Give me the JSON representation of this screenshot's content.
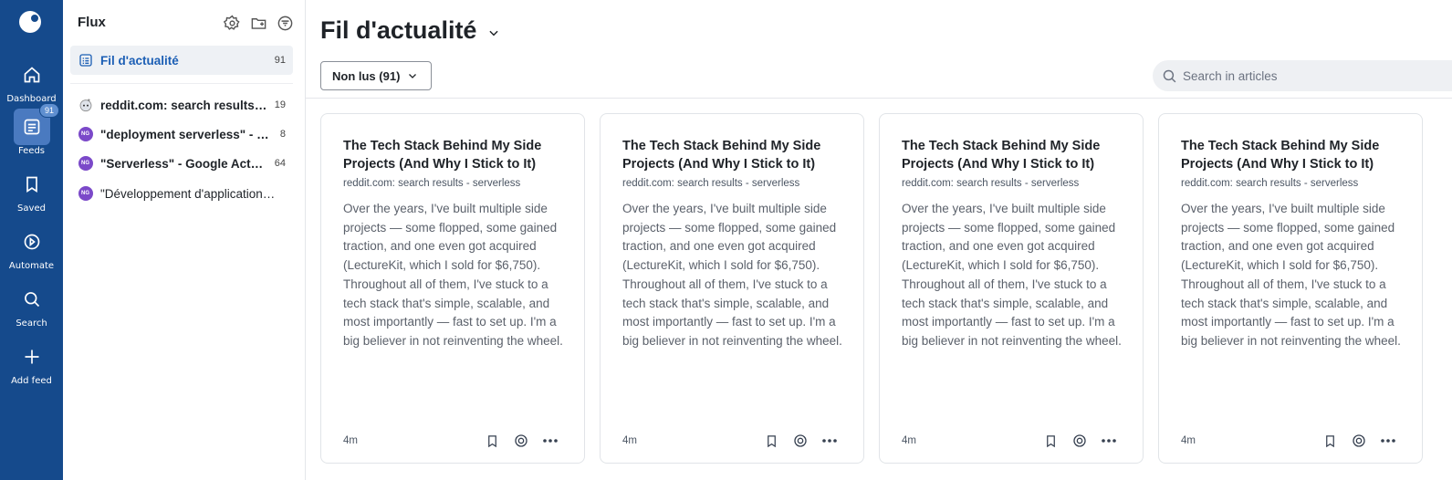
{
  "rail": {
    "items": [
      {
        "label": "Dashboard",
        "icon": "home-icon"
      },
      {
        "label": "Feeds",
        "icon": "feeds-icon",
        "badge": "91"
      },
      {
        "label": "Saved",
        "icon": "bookmark-icon"
      },
      {
        "label": "Automate",
        "icon": "automate-icon"
      },
      {
        "label": "Search",
        "icon": "search-icon"
      },
      {
        "label": "Add feed",
        "icon": "plus-icon"
      }
    ]
  },
  "panel": {
    "title": "Flux",
    "rows": [
      {
        "label": "Fil d'actualité",
        "count": "91",
        "icon": "feed-list-icon"
      },
      {
        "label": "reddit.com: search results - serverless",
        "count": "19",
        "icon": "reddit-icon"
      },
      {
        "label": "\"deployment serverless\" - Google Alerts",
        "count": "8",
        "icon": "ng-avatar",
        "avatar": "NG"
      },
      {
        "label": "\"Serverless\" - Google Actualités",
        "count": "64",
        "icon": "ng-avatar",
        "avatar": "NG"
      },
      {
        "label": "\"Développement d'applications serverless\"",
        "count": "",
        "icon": "ng-avatar",
        "avatar": "NG"
      }
    ]
  },
  "main": {
    "title": "Fil d'actualité",
    "filter_label": "Non lus (91)",
    "search_placeholder": "Search in articles",
    "cards": [
      {
        "title": "The Tech Stack Behind My Side Projects (And Why I Stick to It)",
        "source": "reddit.com: search results - serverless",
        "body": "Over the years, I've built multiple side projects — some flopped, some gained traction, and one even got acquired (LectureKit, which I sold for $6,750). Throughout all of them, I've stuck to a tech stack that's simple, scalable, and most importantly — fast to set up. I'm a big believer in not reinventing the wheel.",
        "time": "4m"
      },
      {
        "title": "The Tech Stack Behind My Side Projects (And Why I Stick to It)",
        "source": "reddit.com: search results - serverless",
        "body": "Over the years, I've built multiple side projects — some flopped, some gained traction, and one even got acquired (LectureKit, which I sold for $6,750). Throughout all of them, I've stuck to a tech stack that's simple, scalable, and most importantly — fast to set up. I'm a big believer in not reinventing the wheel.",
        "time": "4m"
      },
      {
        "title": "The Tech Stack Behind My Side Projects (And Why I Stick to It)",
        "source": "reddit.com: search results - serverless",
        "body": "Over the years, I've built multiple side projects — some flopped, some gained traction, and one even got acquired (LectureKit, which I sold for $6,750). Throughout all of them, I've stuck to a tech stack that's simple, scalable, and most importantly — fast to set up. I'm a big believer in not reinventing the wheel.",
        "time": "4m"
      },
      {
        "title": "The Tech Stack Behind My Side Projects (And Why I Stick to It)",
        "source": "reddit.com: search results - serverless",
        "body": "Over the years, I've built multiple side projects — some flopped, some gained traction, and one even got acquired (LectureKit, which I sold for $6,750). Throughout all of them, I've stuck to a tech stack that's simple, scalable, and most importantly — fast to set up. I'm a big believer in not reinventing the wheel.",
        "time": "4m"
      }
    ]
  },
  "colors": {
    "rail": "#154a8c",
    "accent": "#1c5fb5",
    "avatar": "#7b49c9"
  }
}
